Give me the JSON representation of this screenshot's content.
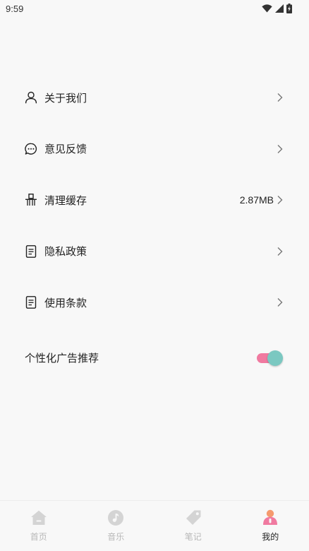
{
  "status_bar": {
    "time": "9:59"
  },
  "menu": {
    "items": [
      {
        "label": "关于我们",
        "icon": "person-icon"
      },
      {
        "label": "意见反馈",
        "icon": "chat-bubble-icon"
      },
      {
        "label": "清理缓存",
        "icon": "broom-icon",
        "value": "2.87MB"
      },
      {
        "label": "隐私政策",
        "icon": "document-icon"
      },
      {
        "label": "使用条款",
        "icon": "document-icon"
      }
    ]
  },
  "ad_recommend": {
    "label": "个性化广告推荐",
    "enabled": true
  },
  "tab_bar": {
    "tabs": [
      {
        "label": "首页",
        "icon": "home-icon"
      },
      {
        "label": "音乐",
        "icon": "music-icon"
      },
      {
        "label": "笔记",
        "icon": "tag-icon"
      },
      {
        "label": "我的",
        "icon": "user-icon",
        "active": true
      }
    ]
  },
  "colors": {
    "toggle_track": "#f07aa0",
    "toggle_knob": "#7bc8c1",
    "tab_inactive": "#d4d4d4",
    "tab_active_head": "#f59a6e",
    "tab_active_body": "#f07aa0"
  }
}
